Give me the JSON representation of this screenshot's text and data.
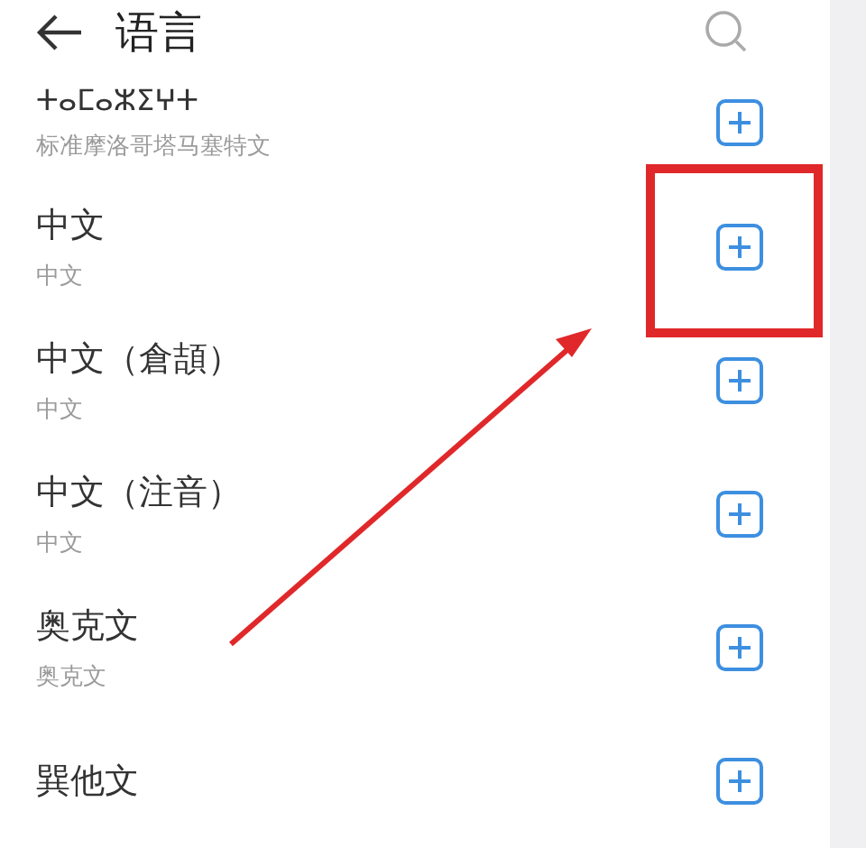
{
  "header": {
    "title": "语言"
  },
  "languages": [
    {
      "name": "ⵜⴰⵎⴰⵣⵉⵖⵜ",
      "subtitle": "标准摩洛哥塔马塞特文",
      "highlighted": false
    },
    {
      "name": "中文",
      "subtitle": "中文",
      "highlighted": true
    },
    {
      "name": "中文（倉頡）",
      "subtitle": "中文",
      "highlighted": false
    },
    {
      "name": "中文（注音）",
      "subtitle": "中文",
      "highlighted": false
    },
    {
      "name": "奥克文",
      "subtitle": "奥克文",
      "highlighted": false
    },
    {
      "name": "巽他文",
      "highlighted": false
    }
  ],
  "annotation": {
    "kind": "arrow"
  }
}
